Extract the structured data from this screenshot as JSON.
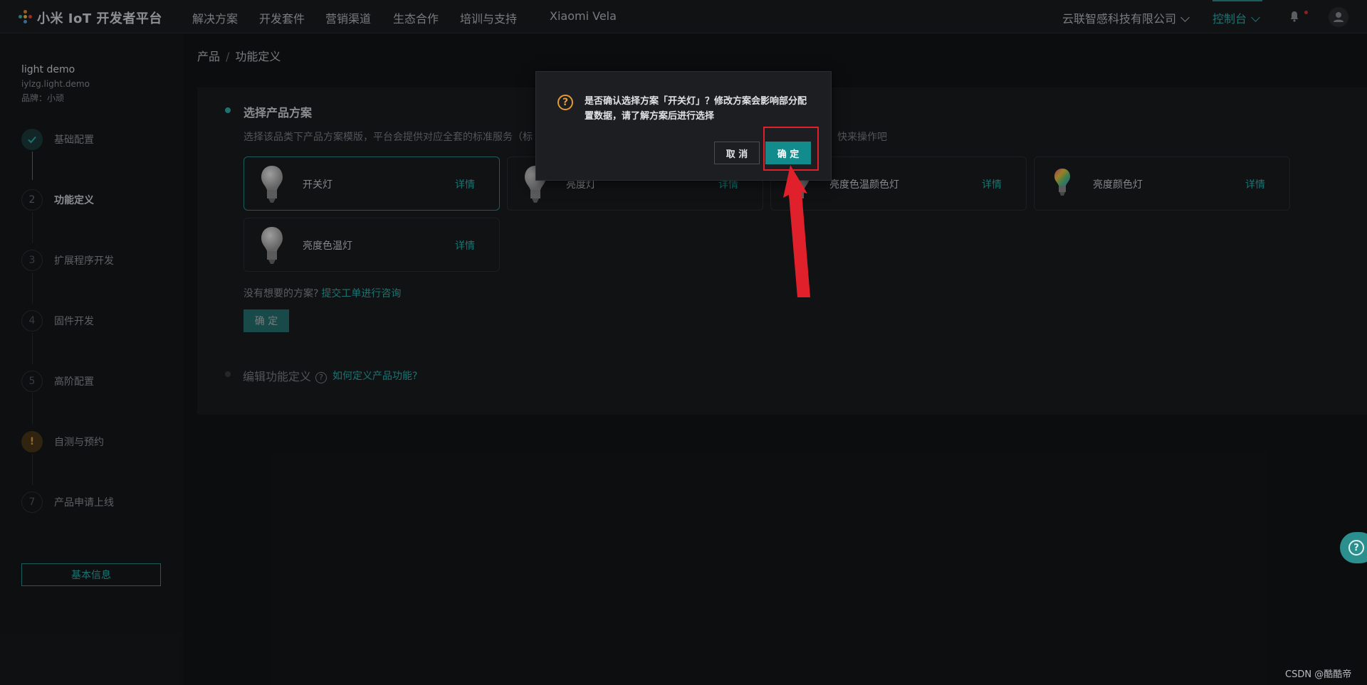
{
  "header": {
    "logo_text": "小米 IoT 开发者平台",
    "nav": [
      "解决方案",
      "开发套件",
      "营销渠道",
      "生态合作",
      "培训与支持",
      "Xiaomi Vela"
    ],
    "company": "云联智感科技有限公司",
    "console": "控制台"
  },
  "sidebar": {
    "product_name": "light demo",
    "product_id": "iylzg.light.demo",
    "brand": "品牌：小顽",
    "steps": [
      {
        "num": "",
        "label": "基础配置"
      },
      {
        "num": "2",
        "label": "功能定义"
      },
      {
        "num": "3",
        "label": "扩展程序开发"
      },
      {
        "num": "4",
        "label": "固件开发"
      },
      {
        "num": "5",
        "label": "高阶配置"
      },
      {
        "num": "!",
        "label": "自测与预约"
      },
      {
        "num": "7",
        "label": "产品申请上线"
      }
    ],
    "basic_info_btn": "基本信息"
  },
  "breadcrumb": {
    "root": "产品",
    "sep": "/",
    "current": "功能定义"
  },
  "section1": {
    "title": "选择产品方案",
    "desc_left": "选择该品类下产品方案模版，平台会提供对应全套的标准服务（标",
    "desc_right": "度，快来操作吧"
  },
  "plans": [
    {
      "name": "开关灯",
      "detail": "详情"
    },
    {
      "name": "亮度灯",
      "detail": "详情"
    },
    {
      "name": "亮度色温颜色灯",
      "detail": "详情"
    },
    {
      "name": "亮度颜色灯",
      "detail": "详情"
    },
    {
      "name": "亮度色温灯",
      "detail": "详情"
    }
  ],
  "no_plan": {
    "text": "没有想要的方案?",
    "link": "提交工单进行咨询"
  },
  "confirm_btn": "确 定",
  "section2": {
    "title": "编辑功能定义",
    "help": "?",
    "link": "如何定义产品功能?"
  },
  "modal": {
    "icon": "?",
    "message": "是否确认选择方案「开关灯」？修改方案会影响部分配置数据，请了解方案后进行选择",
    "cancel": "取 消",
    "ok": "确 定"
  },
  "float_help_icon": "?",
  "watermark": "CSDN @酷酷帝",
  "colors": {
    "accent": "#2cb1ae",
    "warn": "#e49a32",
    "highlight": "#e0202a"
  }
}
